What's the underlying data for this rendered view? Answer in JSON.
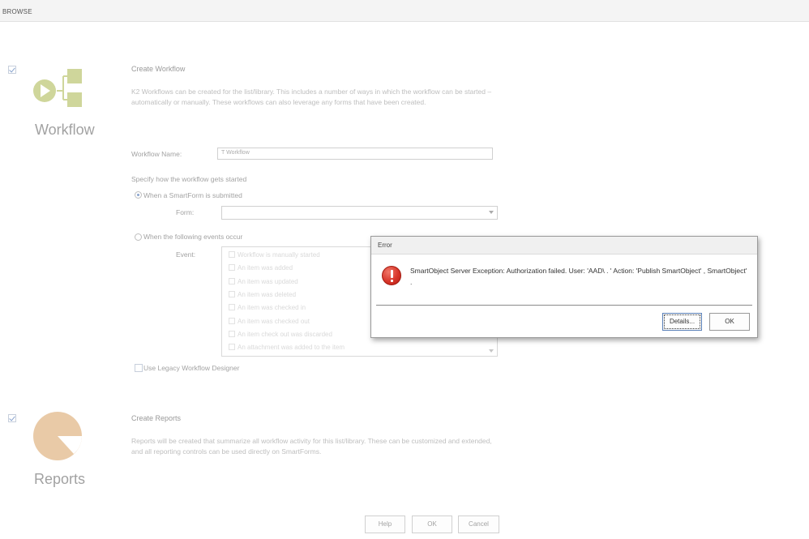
{
  "topbar": {
    "tab_label": "BROWSE"
  },
  "workflow_section": {
    "checked": true,
    "big_label": "Workflow",
    "title": "Create Workflow",
    "description": "K2 Workflows can be created for the list/library.  This includes a number of ways in which the workflow can be started – automatically or manually.  These workflows can also leverage any forms that have been created.",
    "name_label": "Workflow Name:",
    "name_value": "T           Workflow",
    "start_label": "Specify how the workflow gets started",
    "radio_smartform": "When a SmartForm is submitted",
    "form_label": "Form:",
    "form_value": "",
    "radio_events": "When the following events occur",
    "event_label": "Event:",
    "events": [
      "Workflow is manually started",
      "An item was added",
      "An item was updated",
      "An item was deleted",
      "An item was checked in",
      "An item was checked out",
      "An item check out was discarded",
      "An attachment was added to the item"
    ],
    "legacy_label": "Use Legacy Workflow Designer"
  },
  "reports_section": {
    "checked": true,
    "big_label": "Reports",
    "title": "Create Reports",
    "description": "Reports will be created that summarize all workflow activity for this list/library.  These can be customized and extended, and all reporting controls can be used directly on SmartForms."
  },
  "footer_buttons": {
    "help": "Help",
    "ok": "OK",
    "cancel": "Cancel"
  },
  "error_dialog": {
    "title": "Error",
    "message": "SmartObject Server Exception: Authorization failed. User: 'AAD\\ .                      ' Action: 'Publish SmartObject' , SmartObject' .",
    "details_button": "Details...",
    "ok_button": "OK"
  },
  "colors": {
    "workflow_icon": "#a8b64a",
    "reports_icon": "#d8a060",
    "error_icon": "#d8362a",
    "checkbox_check": "#2a5aa8"
  }
}
